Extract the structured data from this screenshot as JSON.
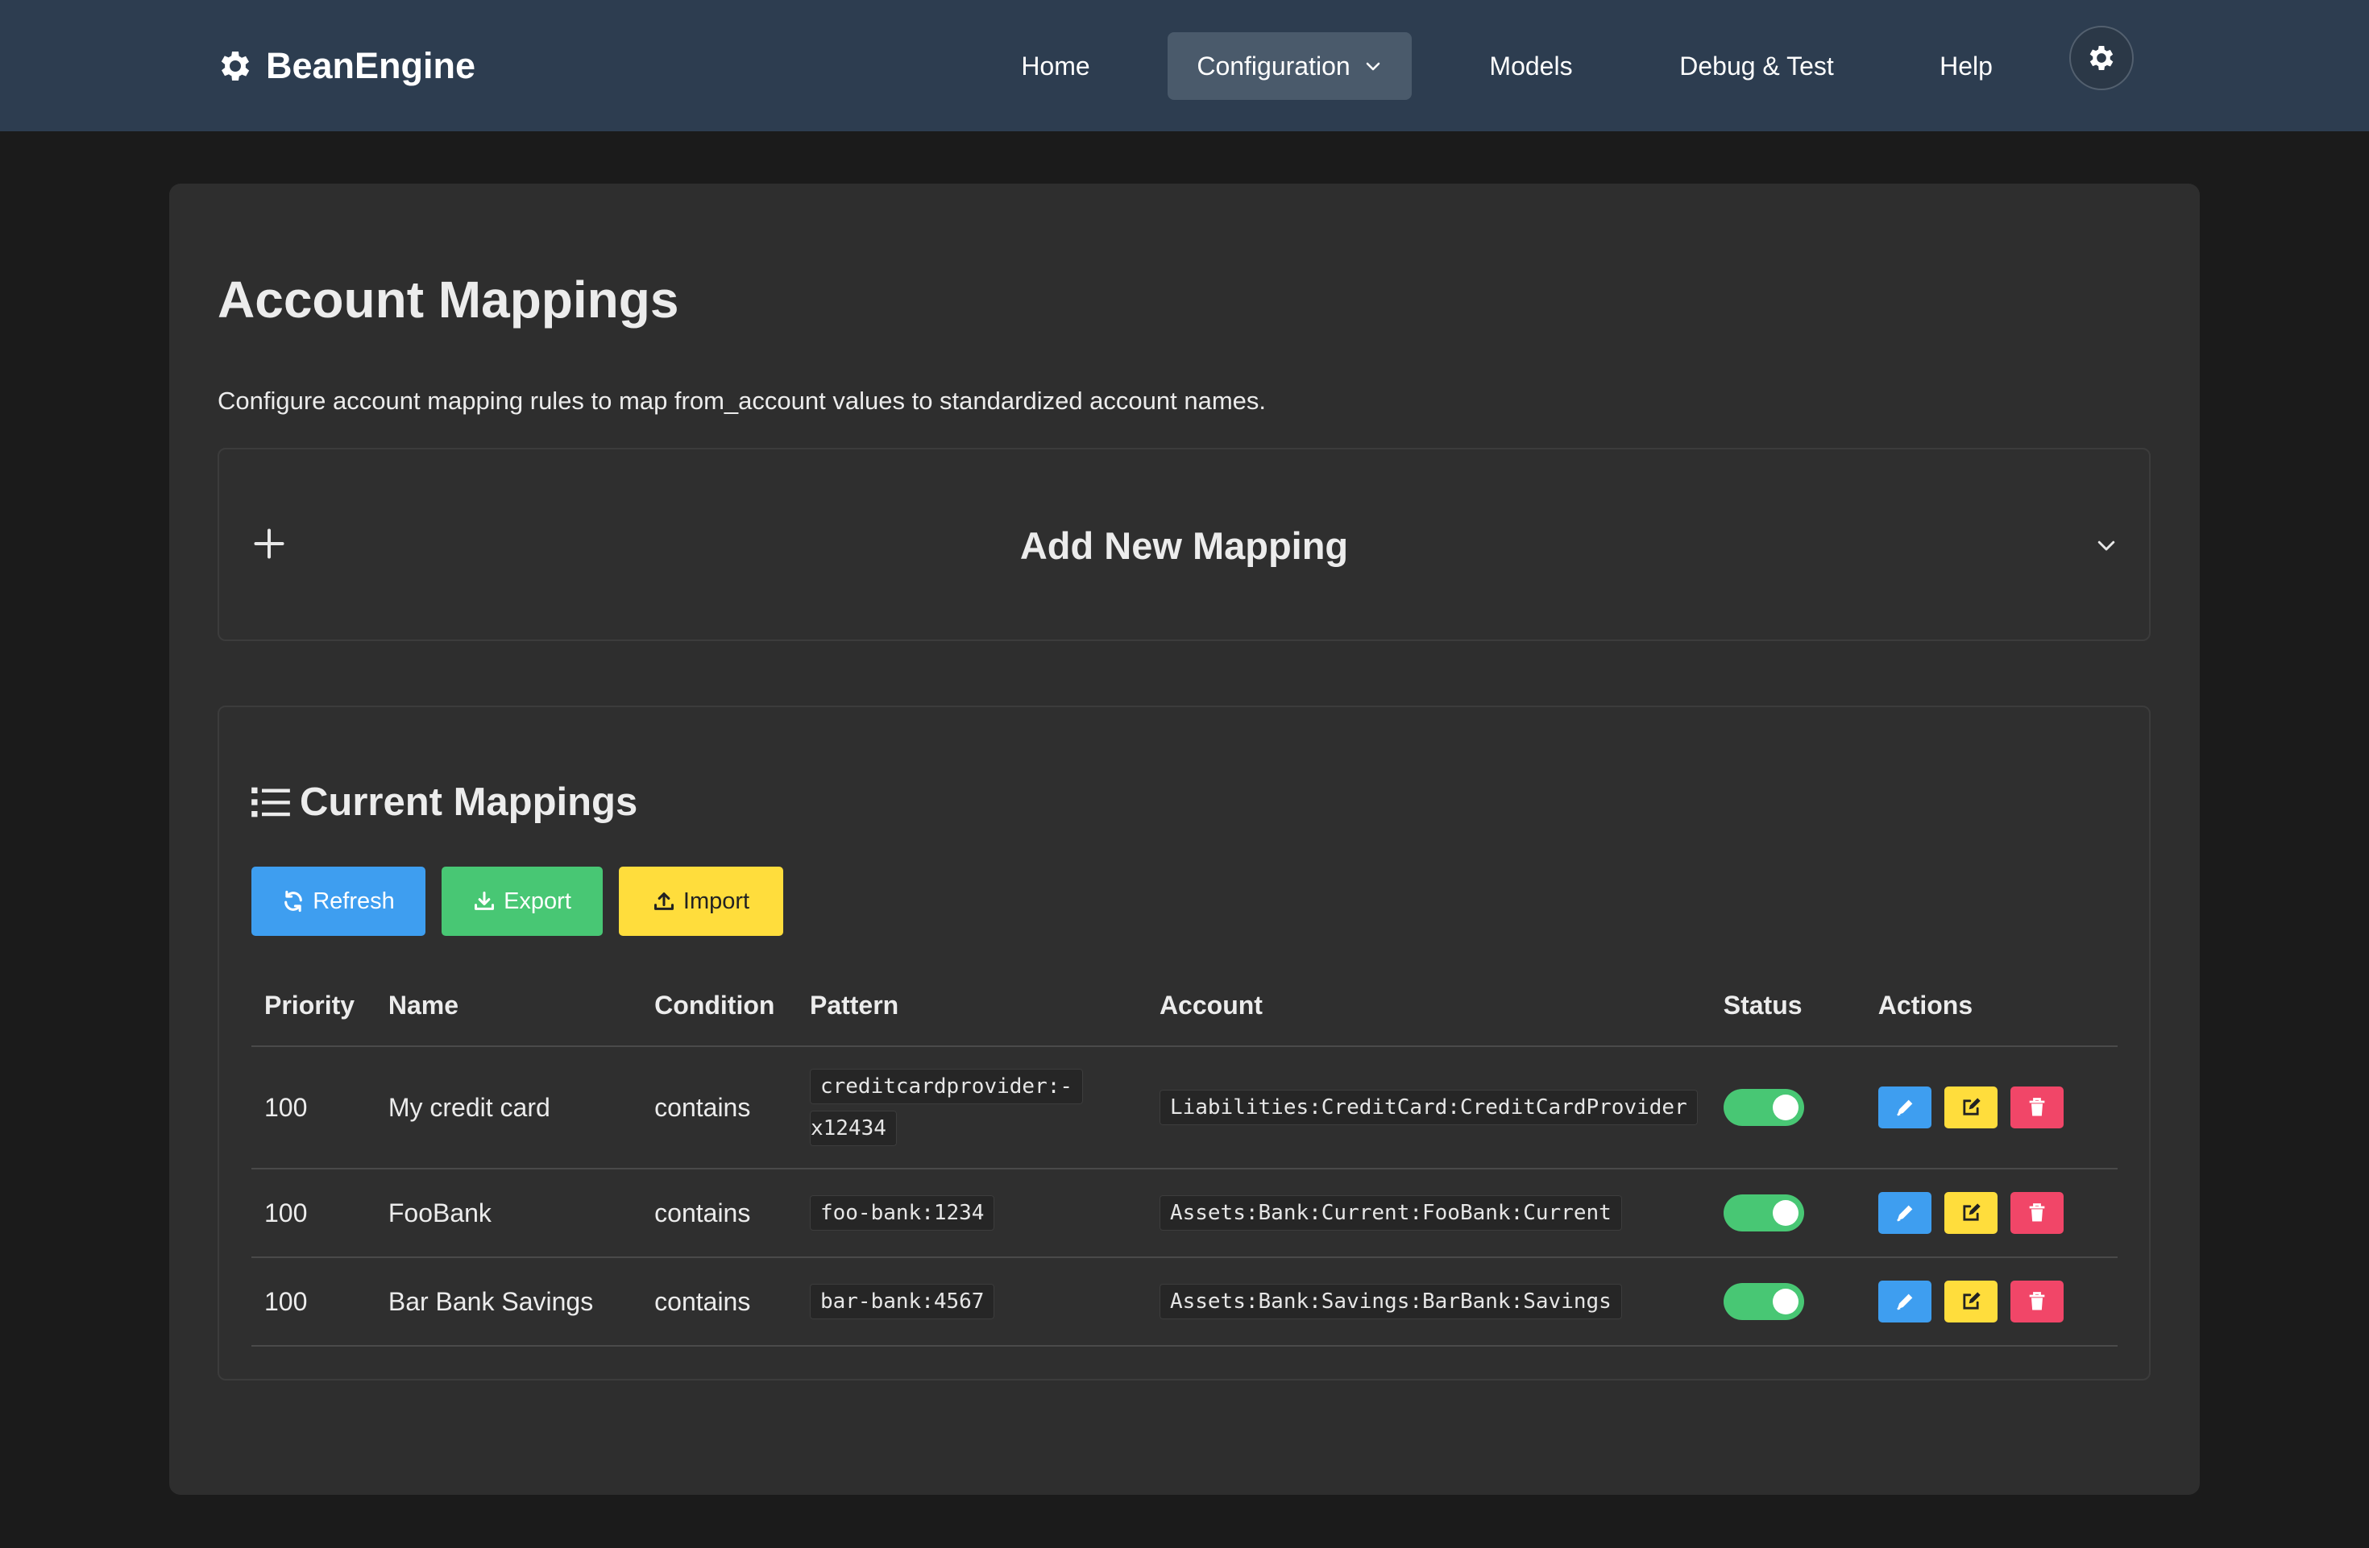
{
  "navbar": {
    "brand": "BeanEngine",
    "items": [
      {
        "label": "Home"
      },
      {
        "label": "Configuration"
      },
      {
        "label": "Models"
      },
      {
        "label": "Debug & Test"
      },
      {
        "label": "Help"
      }
    ],
    "active_item": "Configuration",
    "theme_icon": "gear-icon"
  },
  "page": {
    "title": "Account Mappings",
    "description": "Configure account mapping rules to map from_account values to standardized account names."
  },
  "add_panel": {
    "title": "Add New Mapping"
  },
  "mappings_panel": {
    "title": "Current Mappings",
    "buttons": {
      "refresh": "Refresh",
      "export": "Export",
      "import": "Import"
    },
    "columns": [
      "Priority",
      "Name",
      "Condition",
      "Pattern",
      "Account",
      "Status",
      "Actions"
    ],
    "rows": [
      {
        "priority": "100",
        "name": "My credit card",
        "condition": "contains",
        "pattern_line1": "creditcardprovider:-",
        "pattern_line2": "x12434",
        "account": "Liabilities:CreditCard:CreditCardProvider",
        "enabled": true
      },
      {
        "priority": "100",
        "name": "FooBank",
        "condition": "contains",
        "pattern": "foo-bank:1234",
        "account": "Assets:Bank:Current:FooBank:Current",
        "enabled": true
      },
      {
        "priority": "100",
        "name": "Bar Bank Savings",
        "condition": "contains",
        "pattern": "bar-bank:4567",
        "account": "Assets:Bank:Savings:BarBank:Savings",
        "enabled": true
      }
    ]
  },
  "colors": {
    "navbar": "#2d3d50",
    "primary": "#3e9ef0",
    "success": "#48c774",
    "warning": "#ffdd3c",
    "danger": "#f14668"
  }
}
